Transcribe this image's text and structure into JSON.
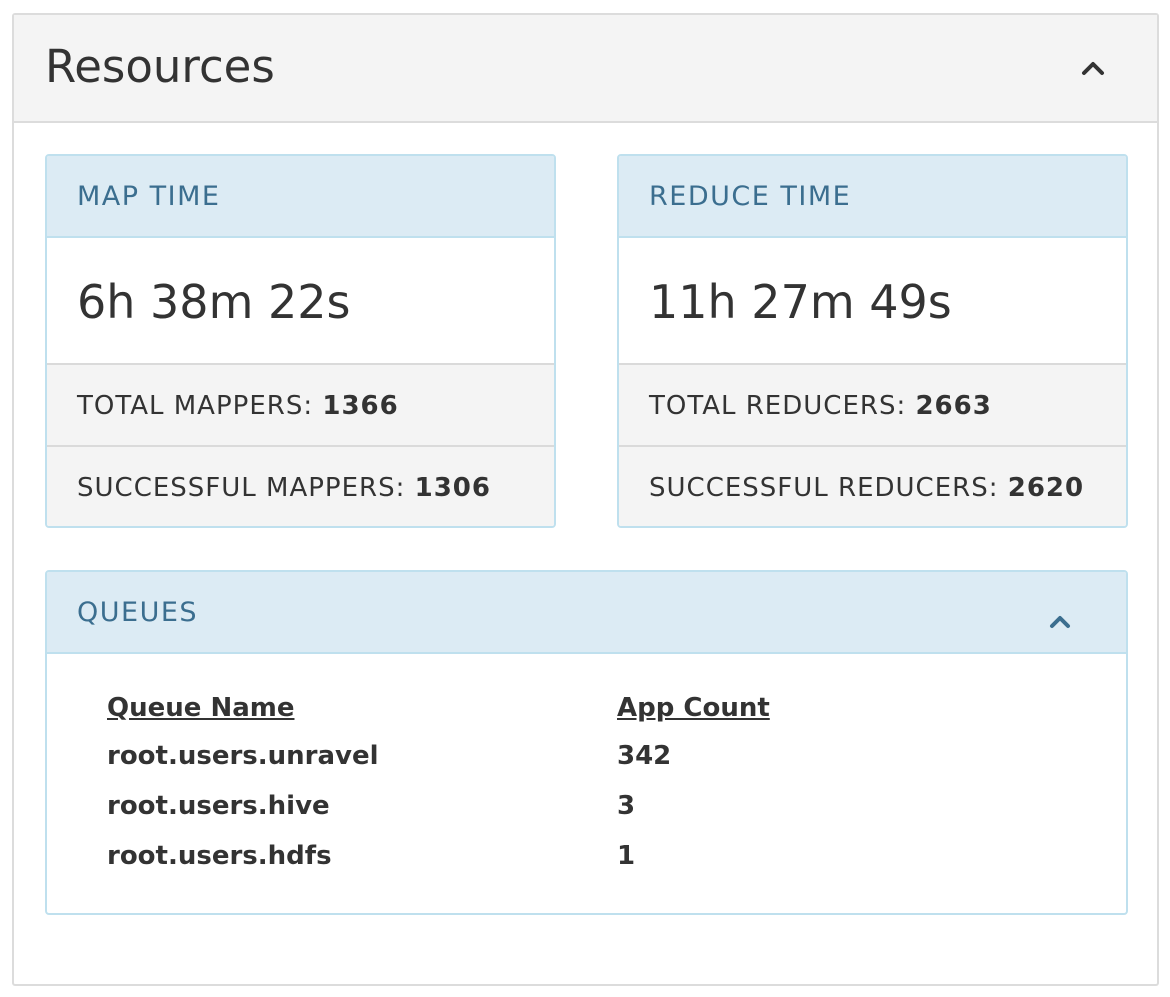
{
  "panel": {
    "title": "Resources",
    "collapse_icon": "chevron-up-icon"
  },
  "map_card": {
    "label": "MAP TIME",
    "value": "6h 38m 22s",
    "total_label": "TOTAL MAPPERS:",
    "total_value": "1366",
    "successful_label": "SUCCESSFUL MAPPERS:",
    "successful_value": "1306"
  },
  "reduce_card": {
    "label": "REDUCE TIME",
    "value": "11h 27m 49s",
    "total_label": "TOTAL REDUCERS:",
    "total_value": "2663",
    "successful_label": "SUCCESSFUL REDUCERS:",
    "successful_value": "2620"
  },
  "queues": {
    "label": "QUEUES",
    "collapse_icon": "chevron-up-icon",
    "columns": [
      "Queue Name",
      "App Count"
    ],
    "rows": [
      {
        "name": "root.users.unravel",
        "count": "342"
      },
      {
        "name": "root.users.hive",
        "count": "3"
      },
      {
        "name": "root.users.hdfs",
        "count": "1"
      }
    ]
  },
  "colors": {
    "card_header_bg": "#dcebf4",
    "card_border": "#bfe0ee",
    "card_label": "#3b6e8f",
    "panel_header_bg": "#f4f4f4"
  }
}
